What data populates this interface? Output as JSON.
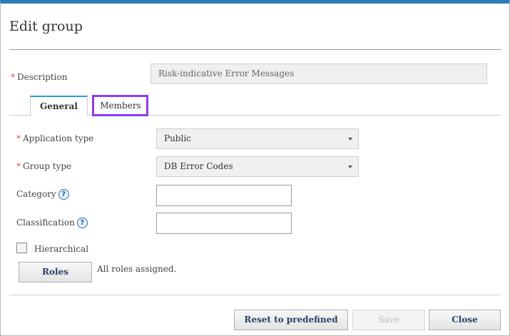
{
  "dialog": {
    "title": "Edit group"
  },
  "description": {
    "required_mark": "*",
    "label": "Description",
    "value": "Risk-indicative Error Messages"
  },
  "tabs": [
    {
      "label": "General",
      "active": true
    },
    {
      "label": "Members",
      "active": false
    }
  ],
  "form": {
    "application_type": {
      "required_mark": "*",
      "label": "Application type",
      "value": "Public"
    },
    "group_type": {
      "required_mark": "*",
      "label": "Group type",
      "value": "DB Error Codes"
    },
    "category": {
      "label": "Category",
      "value": ""
    },
    "classification": {
      "label": "Classification",
      "value": ""
    },
    "hierarchical": {
      "label": "Hierarchical",
      "checked": false
    },
    "help_glyph": "?"
  },
  "roles": {
    "button_label": "Roles",
    "status_text": "All roles assigned."
  },
  "footer": {
    "reset_label": "Reset to predefined",
    "save_label": "Save",
    "close_label": "Close"
  },
  "colors": {
    "accent": "#2e7cb8",
    "highlight": "#8b3df0",
    "required": "#d9534f"
  }
}
